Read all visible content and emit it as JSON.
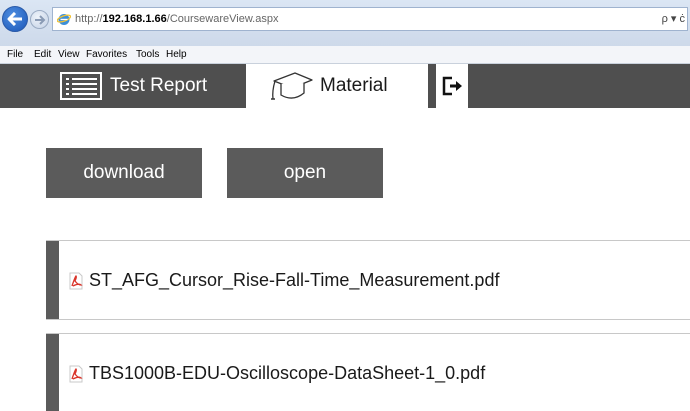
{
  "browser": {
    "url_prefix": "http://",
    "url_host": "192.168.1.66",
    "url_path": "/CoursewareView.aspx",
    "addr_tools": "ρ ▾ ċ",
    "menu": [
      "File",
      "Edit",
      "View",
      "Favorites",
      "Tools",
      "Help"
    ]
  },
  "tabs": {
    "report_label": "Test Report",
    "material_label": "Material"
  },
  "actions": {
    "download_label": "download",
    "open_label": "open"
  },
  "files": [
    {
      "name": "ST_AFG_Cursor_Rise-Fall-Time_Measurement.pdf"
    },
    {
      "name": "TBS1000B-EDU-Oscilloscope-DataSheet-1_0.pdf"
    }
  ],
  "colors": {
    "header": "#4f4f4f",
    "button": "#5b5b5b",
    "pdf": "#d9352b"
  }
}
